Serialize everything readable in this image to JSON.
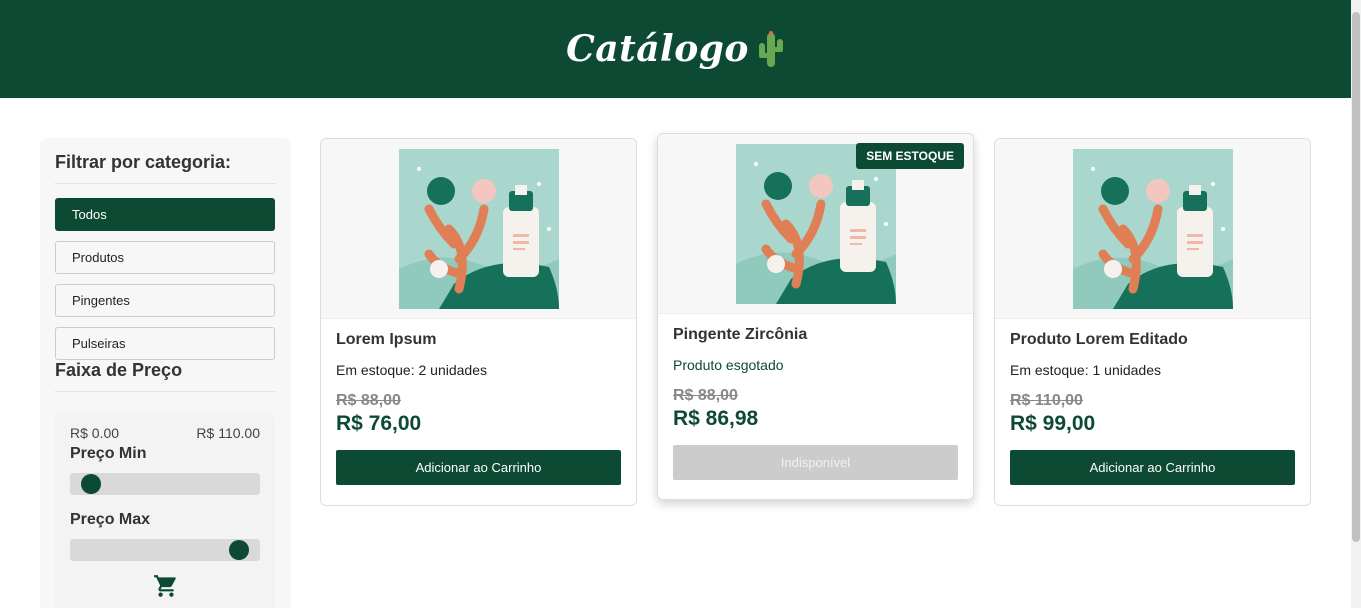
{
  "header": {
    "title": "Catálogo",
    "logo_icon": "cactus-icon"
  },
  "sidebar": {
    "category_title": "Filtrar por categoria:",
    "categories": [
      {
        "label": "Todos",
        "active": true
      },
      {
        "label": "Produtos",
        "active": false
      },
      {
        "label": "Pingentes",
        "active": false
      },
      {
        "label": "Pulseiras",
        "active": false
      }
    ],
    "price_title": "Faixa de Preço",
    "price_min_value": "R$ 0.00",
    "price_max_value": "R$ 110.00",
    "min_label": "Preço Min",
    "max_label": "Preço Max",
    "min_slider_fraction": 0.0,
    "max_slider_fraction": 1.0,
    "cart_icon": "cart-icon"
  },
  "products": [
    {
      "name": "Lorem Ipsum",
      "stock": "Em estoque: 2 unidades",
      "old_price": "R$ 88,00",
      "price": "R$ 76,00",
      "button": "Adicionar ao Carrinho",
      "available": true
    },
    {
      "name": "Pingente Zircônia",
      "stock": "Produto esgotado",
      "old_price": "R$ 88,00",
      "price": "R$ 86,98",
      "button": "Indisponível",
      "available": false,
      "badge": "SEM ESTOQUE"
    },
    {
      "name": "Produto Lorem Editado",
      "stock": "Em estoque: 1 unidades",
      "old_price": "R$ 110,00",
      "price": "R$ 99,00",
      "button": "Adicionar ao Carrinho",
      "available": true
    }
  ],
  "colors": {
    "brand": "#0d4a33",
    "image_bg": "#a8d5cc"
  }
}
